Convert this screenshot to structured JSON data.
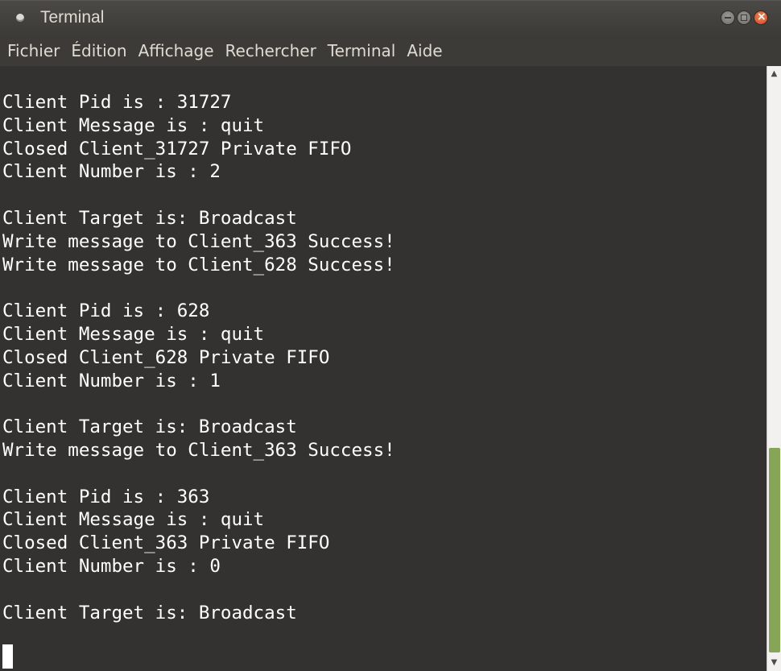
{
  "window": {
    "title": "Terminal"
  },
  "menu": {
    "items": [
      "Fichier",
      "Édition",
      "Affichage",
      "Rechercher",
      "Terminal",
      "Aide"
    ]
  },
  "terminal": {
    "lines": [
      "Client Pid is : 31727",
      "Client Message is : quit",
      "Closed Client_31727 Private FIFO",
      "Client Number is : 2",
      "",
      "Client Target is: Broadcast",
      "Write message to Client_363 Success!",
      "Write message to Client_628 Success!",
      "",
      "Client Pid is : 628",
      "Client Message is : quit",
      "Closed Client_628 Private FIFO",
      "Client Number is : 1",
      "",
      "Client Target is: Broadcast",
      "Write message to Client_363 Success!",
      "",
      "Client Pid is : 363",
      "Client Message is : quit",
      "Closed Client_363 Private FIFO",
      "Client Number is : 0",
      "",
      "Client Target is: Broadcast"
    ]
  },
  "scrollbar": {
    "up_glyph": "▲",
    "down_glyph": "▼",
    "accent_color": "#87a556"
  },
  "colors": {
    "close_button": "#d5421a",
    "terminal_text": "#ffffff"
  },
  "icons": {
    "title": "terminal-app-icon",
    "minimize": "minimize-icon",
    "maximize": "maximize-icon",
    "close": "close-icon"
  }
}
